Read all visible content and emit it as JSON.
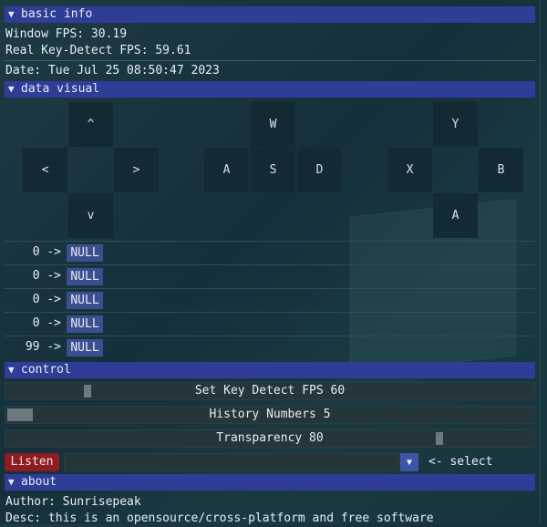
{
  "basic_info": {
    "header": "basic info",
    "window_fps": "Window FPS: 30.19",
    "real_fps": "Real Key-Detect FPS: 59.61",
    "date": "Date: Tue Jul 25 08:50:47 2023"
  },
  "data_visual": {
    "header": "data visual",
    "dpad": {
      "up": "^",
      "left": "<",
      "right": ">",
      "down": "v"
    },
    "wasd": {
      "w": "W",
      "a": "A",
      "s": "S",
      "d": "D"
    },
    "xyab": {
      "y": "Y",
      "x": "X",
      "b": "B",
      "a": "A"
    },
    "history": [
      {
        "num": "0 ->",
        "value": "NULL"
      },
      {
        "num": "0 ->",
        "value": "NULL"
      },
      {
        "num": "0 ->",
        "value": "NULL"
      },
      {
        "num": "0 ->",
        "value": "NULL"
      },
      {
        "num": "99 ->",
        "value": "NULL"
      }
    ]
  },
  "control": {
    "header": "control",
    "fps_slider": {
      "label": "Set Key Detect FPS 60",
      "value": 60
    },
    "history_slider": {
      "label": "History Numbers 5",
      "value": 5
    },
    "transparency_slider": {
      "label": "Transparency 80",
      "value": 80
    },
    "listen_label": "Listen",
    "combo_value": "",
    "select_label": "<- select"
  },
  "about": {
    "header": "about",
    "author": "Author: Sunrisepeak",
    "desc": "Desc: this is an opensource/cross-platform and free software"
  },
  "colors": {
    "header_bg": "#2f3d97",
    "listen_bg": "#8e1c22",
    "key_bg": "#142a32",
    "null_bg": "#3b4f8f"
  }
}
